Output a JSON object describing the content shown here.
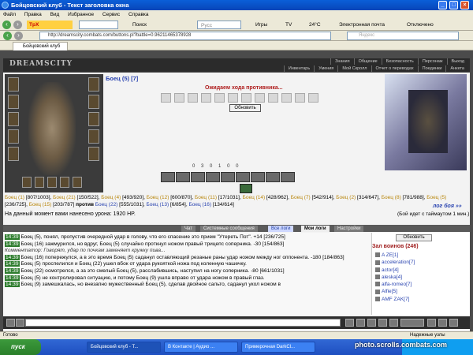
{
  "window": {
    "title": "Бойцовский клуб - Текст заголовка окна"
  },
  "menu": [
    "Файл",
    "Правка",
    "Вид",
    "Избранное",
    "Сервис",
    "Справка"
  ],
  "toolbar": {
    "search": "Поиск",
    "games": "Игры",
    "tv": "TV",
    "temp": "24°С",
    "mail": "Электронная почта",
    "off": "Отключено",
    "rus": "Русс"
  },
  "address": {
    "url": "http://dreamscity.combats.com/buttons.pl?battle=0.96211465378928",
    "search_placeholder": "Яндекс"
  },
  "tab": {
    "label": "Бойцовский клуб"
  },
  "site": {
    "logo": "DREAMSCITY",
    "nav1": [
      "Знания",
      "Общение",
      "Безопасность",
      "Персонаж",
      "Выход"
    ],
    "nav2": [
      "Инвентарь",
      "Умения",
      "Мой Скролл",
      "Отчет о переводах",
      "Поединки",
      "Анкета"
    ]
  },
  "battle": {
    "player": "Боец (5) [7]",
    "waiting": "Ожидаем хода противника...",
    "refresh": "Обновить",
    "stats": [
      "0",
      "3",
      "0",
      "1",
      "0",
      "0"
    ],
    "team1": [
      {
        "name": "Боец (1)",
        "hp": "[807/1003]"
      },
      {
        "name": "Боец (21)",
        "hp": "[150/522]"
      },
      {
        "name": "Боец (4)",
        "hp": "[493/920]"
      },
      {
        "name": "Боец (12)",
        "hp": "[600/870]"
      },
      {
        "name": "Боец (11)",
        "hp": "[17/1031]"
      },
      {
        "name": "Боец (14)",
        "hp": "[428/962]"
      },
      {
        "name": "Боец (7)",
        "hp": "[542/914]"
      },
      {
        "name": "Боец (2)",
        "hp": "[314/647]"
      },
      {
        "name": "Боец (8)",
        "hp": "[781/988]"
      },
      {
        "name": "Боец (5)",
        "hp": "[236/725]"
      },
      {
        "name": "Боец (15)",
        "hp": "[203/787]"
      }
    ],
    "versus": "против",
    "team2": [
      {
        "name": "Боец (22)",
        "hp": "[555/1031]"
      },
      {
        "name": "Боец (13)",
        "hp": "[6/854]"
      },
      {
        "name": "Боец (16)",
        "hp": "[134/614]"
      }
    ],
    "damage": "На данный момент вами нанесено урона: 1920 HP.",
    "log_link": "лог боя »»",
    "timeout": "(Бой идет с таймаутом 1 мин.)"
  },
  "chat_tabs": [
    "Чат",
    "Системные сообщения",
    "Все логи",
    "Мои логи",
    "Настройки"
  ],
  "chat": [
    {
      "time": "14:39",
      "text": "Боец (5), понял, пропустив очередной удар в голову, что его спасение это прием \"Утереть Пот\". +14 [236/725]"
    },
    {
      "time": "14:39",
      "text": "Боец (16) зажмурился, но вдруг, Боец (5) случайно проткнул ножом правый трицепс соперника. -30 [154/863]"
    },
    {
      "time": "",
      "text": "Комментатор: Говорят, удар по почкам заменяет кружку пива..."
    },
    {
      "time": "14:39",
      "text": "Боец (16) попережулся, а в это время Боец (5) саданул оставляющий резаные раны удар ножом между ног оппонента. -180 [184/863]"
    },
    {
      "time": "14:39",
      "text": "Боец (5) проспелился и Боец (22) ушел вбок от удара рукояткой ножа под коленную чашечку."
    },
    {
      "time": "14:39",
      "text": "Боец (22) осмотрелся, а за это смелый Боец (5), расслабившись, наступил на ногу соперника. -80 [661/1031]"
    },
    {
      "time": "14:39",
      "text": "Боец (5) не контролировал ситуацию, и потому Боец (9) ушла вправо от удара ножом в правый глаз."
    },
    {
      "time": "14:39",
      "text": "Боец (9) замешкалась, но внезапно мужественный Боец (5), сделав двойное сальто, саданул укол ножом в"
    }
  ],
  "side": {
    "refresh": "Обновить",
    "header": "Зал воинов (246)",
    "users": [
      "A ZE[1]",
      "acceleration[7]",
      "actor[4]",
      "aleska[4]",
      "alfa-romeo[7]",
      "Alfie[5]",
      "AMF ZAK[7]"
    ]
  },
  "status": {
    "done": "Готово",
    "zone": "Надежные узлы"
  },
  "taskbar": {
    "start": "пуск",
    "tasks": [
      "Бойцовский клуб - Т...",
      "В Контакте | Аудио ...",
      "Примерочная DarkCl..."
    ]
  },
  "watermark": "photo.scrolls.combats.com"
}
